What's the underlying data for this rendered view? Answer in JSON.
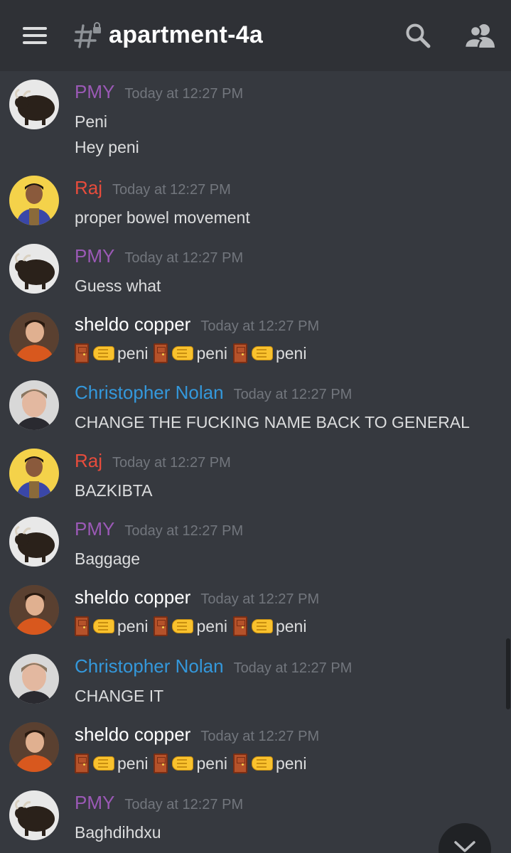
{
  "header": {
    "channel_name": "apartment-4a"
  },
  "icons": {
    "menu": "hamburger-menu-icon",
    "channel": "locked-text-channel-icon",
    "search": "search-icon",
    "members": "members-icon",
    "jump": "chevron-down-icon"
  },
  "colors": {
    "pmy": "#9b59b6",
    "raj": "#e74c3c",
    "sheldo": "#ffffff",
    "nolan": "#3498db",
    "background": "#36393f",
    "header": "#2f3136",
    "timestamp": "#72767d"
  },
  "messages": [
    {
      "author": "PMY",
      "time": "Today at 12:27 PM",
      "lines": [
        "Peni",
        "Hey peni"
      ]
    },
    {
      "author": "Raj",
      "time": "Today at 12:27 PM",
      "lines": [
        "proper bowel movement"
      ]
    },
    {
      "author": "PMY",
      "time": "Today at 12:27 PM",
      "lines": [
        "Guess what"
      ]
    },
    {
      "author": "sheldo copper",
      "time": "Today at 12:27 PM",
      "emoji_lines": [
        "peni",
        "peni",
        "peni"
      ]
    },
    {
      "author": "Christopher Nolan",
      "time": "Today at 12:27 PM",
      "lines": [
        "CHANGE THE FUCKING NAME BACK TO GENERAL"
      ]
    },
    {
      "author": "Raj",
      "time": "Today at 12:27 PM",
      "lines": [
        "BAZKIBTA"
      ]
    },
    {
      "author": "PMY",
      "time": "Today at 12:27 PM",
      "lines": [
        "Baggage"
      ]
    },
    {
      "author": "sheldo copper",
      "time": "Today at 12:27 PM",
      "emoji_lines": [
        "peni",
        "peni",
        "peni"
      ]
    },
    {
      "author": "Christopher Nolan",
      "time": "Today at 12:27 PM",
      "lines": [
        "CHANGE IT"
      ]
    },
    {
      "author": "sheldo copper",
      "time": "Today at 12:27 PM",
      "emoji_lines": [
        "peni",
        "peni",
        "peni"
      ]
    },
    {
      "author": "PMY",
      "time": "Today at 12:27 PM",
      "lines": [
        "Baghdihdxu"
      ]
    }
  ]
}
